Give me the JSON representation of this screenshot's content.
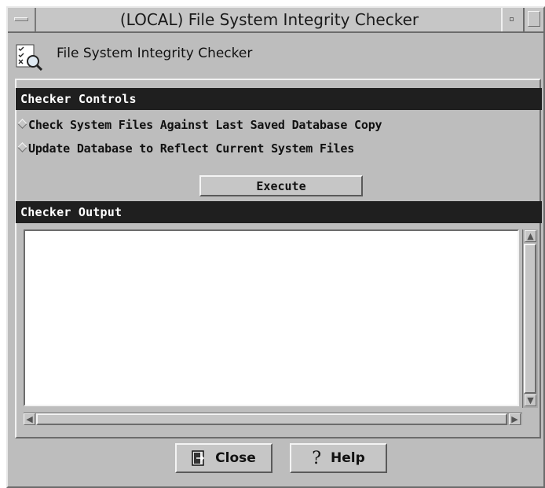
{
  "window": {
    "title": "(LOCAL) File System Integrity Checker"
  },
  "header": {
    "title": "File System Integrity Checker",
    "icon": "checklist-magnifier-icon"
  },
  "controls": {
    "section_title": "Checker Controls",
    "options": [
      {
        "label": "Check System Files Against Last Saved Database Copy",
        "selected": false
      },
      {
        "label": "Update Database to Reflect Current System Files",
        "selected": false
      }
    ],
    "execute_label": "Execute"
  },
  "output": {
    "section_title": "Checker Output",
    "text": ""
  },
  "footer": {
    "close_label": "Close",
    "help_label": "Help"
  },
  "colors": {
    "window_bg": "#bdbdbd",
    "section_header_bg": "#1f1f1f",
    "section_header_text": "#ffffff",
    "output_bg": "#ffffff"
  }
}
